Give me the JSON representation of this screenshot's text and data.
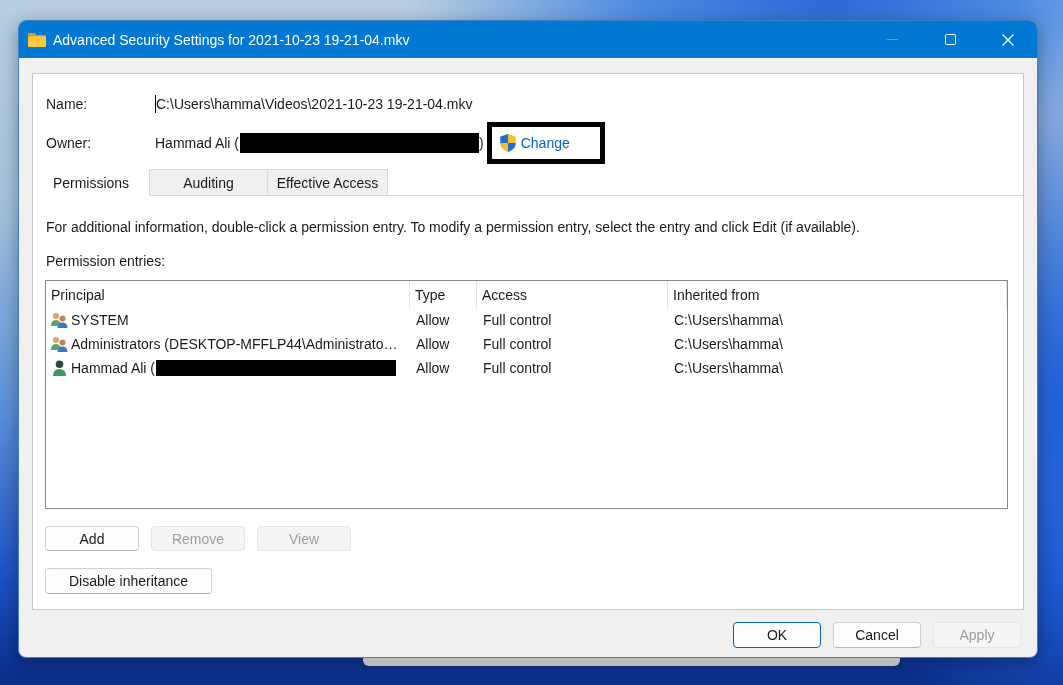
{
  "window": {
    "title": "Advanced Security Settings for 2021-10-23 19-21-04.mkv",
    "controls": [
      {
        "kind": "minimize",
        "disabled": true
      },
      {
        "kind": "maximize",
        "disabled": false
      },
      {
        "kind": "close",
        "disabled": false
      }
    ]
  },
  "name": {
    "label": "Name:",
    "value": "C:\\Users\\hamma\\Videos\\2021-10-23 19-21-04.mkv",
    "focused": true
  },
  "owner": {
    "label": "Owner:",
    "value": "Hammad Ali (",
    "redacted": true,
    "value_end": ")",
    "change_link": "Change",
    "change_highlighted": true
  },
  "tabs": [
    {
      "label": "Permissions",
      "selected": true
    },
    {
      "label": "Auditing",
      "selected": false
    },
    {
      "label": "Effective Access",
      "selected": false
    }
  ],
  "info_text": "For additional information, double-click a permission entry. To modify a permission entry, select the entry and click Edit (if available).",
  "entries_label": "Permission entries:",
  "table": {
    "columns": [
      "Principal",
      "Type",
      "Access",
      "Inherited from"
    ],
    "rows": [
      {
        "kind": "group",
        "principal": "SYSTEM",
        "redacted": false,
        "type": "Allow",
        "access": "Full control",
        "inherited_from": "C:\\Users\\hamma\\"
      },
      {
        "kind": "group",
        "principal": "Administrators (DESKTOP-MFFLP44\\Administrato…",
        "redacted": false,
        "type": "Allow",
        "access": "Full control",
        "inherited_from": "C:\\Users\\hamma\\"
      },
      {
        "kind": "user",
        "principal": "Hammad Ali (",
        "redacted": true,
        "type": "Allow",
        "access": "Full control",
        "inherited_from": "C:\\Users\\hamma\\"
      }
    ]
  },
  "entry_buttons": [
    {
      "label": "Add",
      "disabled": false
    },
    {
      "label": "Remove",
      "disabled": true
    },
    {
      "label": "View",
      "disabled": true
    }
  ],
  "inheritance_button": {
    "label": "Disable inheritance",
    "disabled": false
  },
  "dialog_buttons": [
    {
      "label": "OK",
      "default": true,
      "disabled": false
    },
    {
      "label": "Cancel",
      "default": false,
      "disabled": false
    },
    {
      "label": "Apply",
      "default": false,
      "disabled": true
    }
  ]
}
